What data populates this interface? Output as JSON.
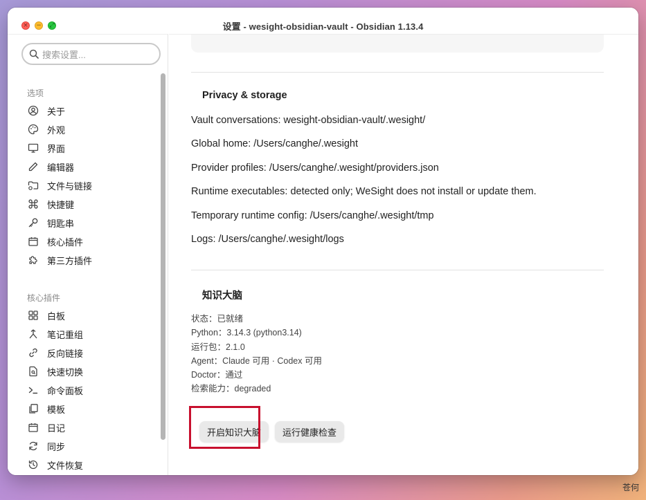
{
  "window": {
    "title": "设置 - wesight-obsidian-vault - Obsidian 1.13.4"
  },
  "search": {
    "placeholder": "搜索设置..."
  },
  "sidebar": {
    "options_label": "选项",
    "options": [
      {
        "label": "关于",
        "icon": "user-circle-icon"
      },
      {
        "label": "外观",
        "icon": "palette-icon"
      },
      {
        "label": "界面",
        "icon": "monitor-icon"
      },
      {
        "label": "编辑器",
        "icon": "pen-icon"
      },
      {
        "label": "文件与链接",
        "icon": "folder-link-icon"
      },
      {
        "label": "快捷键",
        "icon": "command-icon"
      },
      {
        "label": "钥匙串",
        "icon": "key-icon"
      },
      {
        "label": "核心插件",
        "icon": "calendar-plugin-icon"
      },
      {
        "label": "第三方插件",
        "icon": "puzzle-icon"
      }
    ],
    "core_label": "核心插件",
    "core": [
      {
        "label": "白板",
        "icon": "canvas-icon"
      },
      {
        "label": "笔记重组",
        "icon": "merge-icon"
      },
      {
        "label": "反向链接",
        "icon": "backlink-icon"
      },
      {
        "label": "快速切换",
        "icon": "file-search-icon"
      },
      {
        "label": "命令面板",
        "icon": "terminal-icon"
      },
      {
        "label": "模板",
        "icon": "files-icon"
      },
      {
        "label": "日记",
        "icon": "calendar-icon"
      },
      {
        "label": "同步",
        "icon": "sync-icon"
      },
      {
        "label": "文件恢复",
        "icon": "history-icon"
      }
    ]
  },
  "privacy": {
    "heading": "Privacy & storage",
    "lines": [
      "Vault conversations: wesight-obsidian-vault/.wesight/",
      "Global home: /Users/canghe/.wesight",
      "Provider profiles: /Users/canghe/.wesight/providers.json",
      "Runtime executables: detected only; WeSight does not install or update them.",
      "Temporary runtime config: /Users/canghe/.wesight/tmp",
      "Logs: /Users/canghe/.wesight/logs"
    ]
  },
  "brain": {
    "heading": "知识大脑",
    "status": [
      "状态：已就绪",
      "Python：3.14.3 (python3.14)",
      "运行包：2.1.0",
      "Agent：Claude 可用 · Codex 可用",
      "Doctor：通过",
      "检索能力：degraded"
    ],
    "enable_button": "开启知识大脑",
    "check_button": "运行健康检查"
  },
  "watermark": "苍何"
}
